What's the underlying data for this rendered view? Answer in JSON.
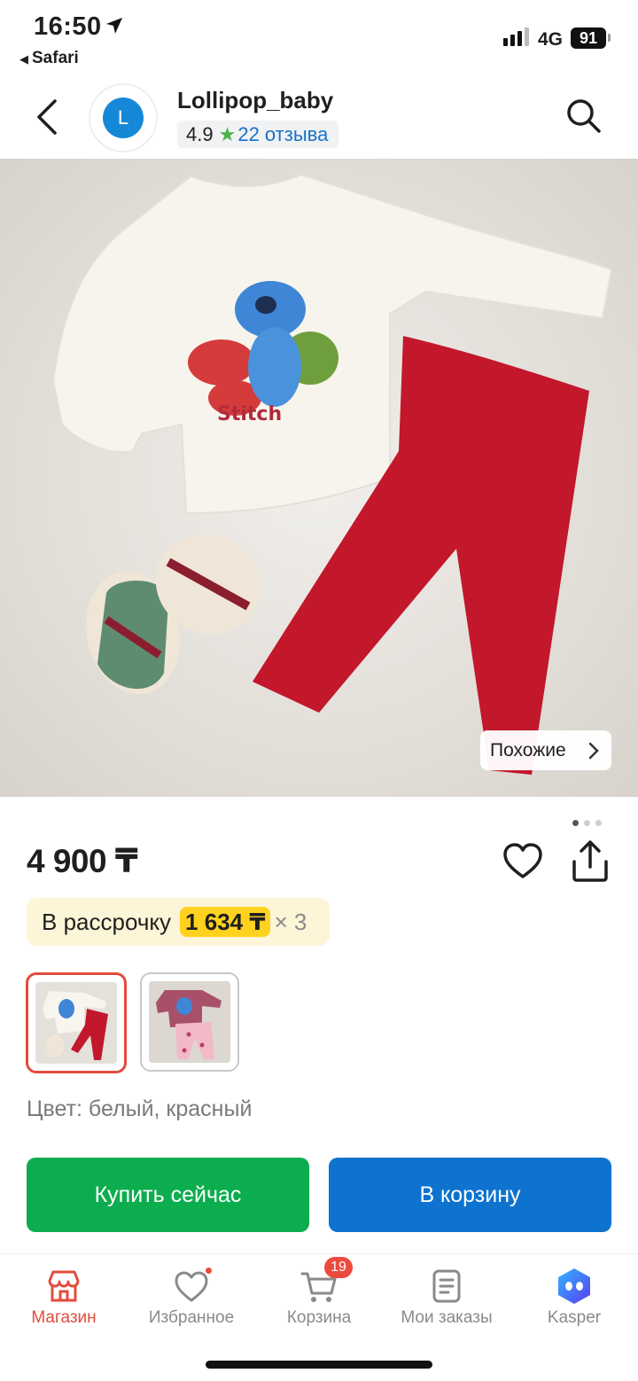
{
  "status_bar": {
    "time": "16:50",
    "back_app": "Safari",
    "network": "4G",
    "battery": "91"
  },
  "header": {
    "avatar_letter": "L",
    "shop_name": "Lollipop_baby",
    "rating": "4.9",
    "reviews": "22 отзыва"
  },
  "product": {
    "similar_label": "Похожие",
    "price": "4 900 ₸",
    "installment_label": "В рассрочку",
    "installment_amount": "1 634 ₸",
    "installment_multiplier": "× 3",
    "color_line": "Цвет: белый, красный",
    "image_count": 3,
    "current_image": 1
  },
  "actions": {
    "buy_now": "Купить сейчас",
    "add_to_cart": "В корзину"
  },
  "tabbar": {
    "items": [
      {
        "label": "Магазин",
        "icon": "shop-icon",
        "active": true
      },
      {
        "label": "Избранное",
        "icon": "heart-icon"
      },
      {
        "label": "Корзина",
        "icon": "cart-icon",
        "badge": "19"
      },
      {
        "label": "Мои заказы",
        "icon": "orders-icon"
      },
      {
        "label": "Kasper",
        "icon": "kasper-icon"
      }
    ]
  },
  "colors": {
    "accent_red": "#e24c3c",
    "buy_green": "#0cad4e",
    "cart_blue": "#0e73cf",
    "installment_bg": "#fdf5d7",
    "installment_highlight": "#ffd21f"
  }
}
